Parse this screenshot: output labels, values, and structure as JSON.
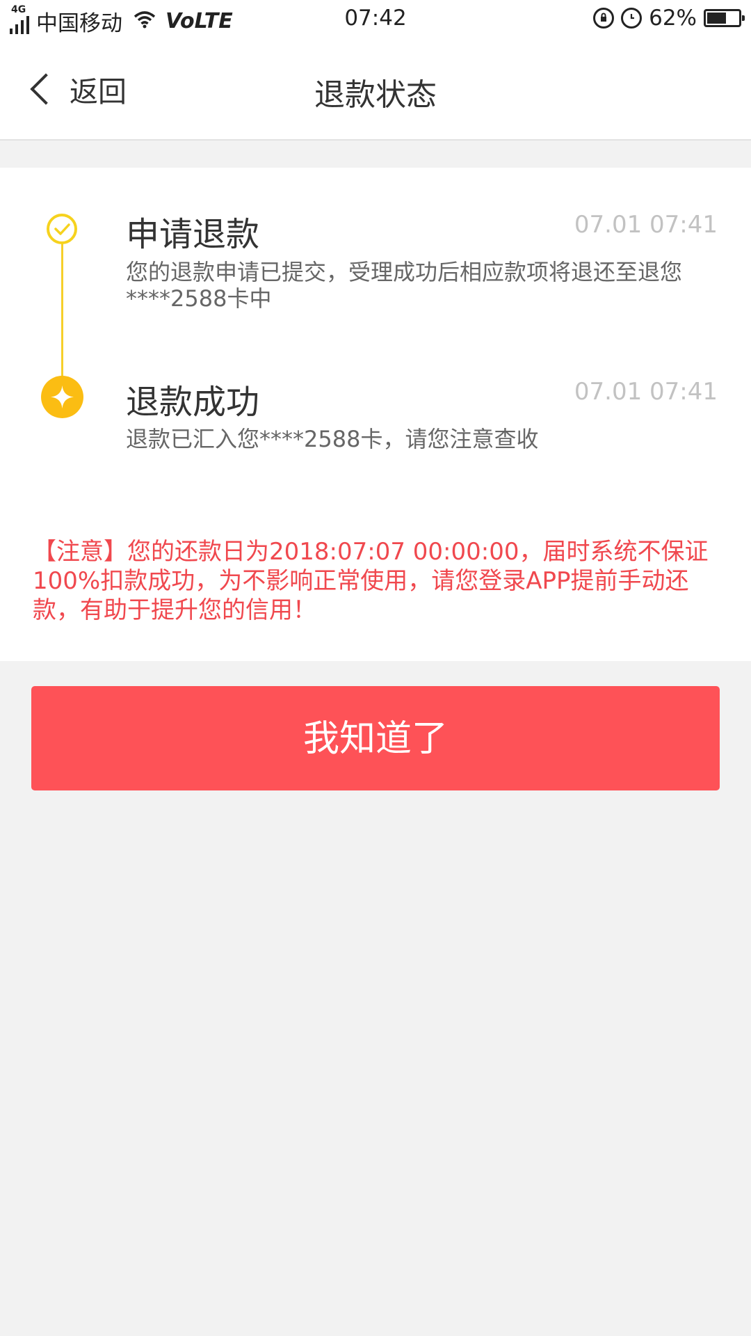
{
  "status_bar": {
    "network_type": "4G",
    "carrier": "中国移动",
    "volte": "VoLTE",
    "time": "07:42",
    "battery_percent": "62%",
    "battery_level": 0.62,
    "icons": [
      "signal-icon",
      "wifi-icon",
      "rotation-lock-icon",
      "alarm-icon",
      "battery-icon"
    ]
  },
  "nav": {
    "back_label": "返回",
    "title": "退款状态"
  },
  "timeline": [
    {
      "title": "申请退款",
      "time": "07.01 07:41",
      "description": "您的退款申请已提交，受理成功后相应款项将退还至退您****2588卡中",
      "icon": "check-circle-icon",
      "color": "#f6d21e"
    },
    {
      "title": "退款成功",
      "time": "07.01 07:41",
      "description": "退款已汇入您****2588卡，请您注意查收",
      "icon": "sparkle-circle-icon",
      "color": "#fbbd13"
    }
  ],
  "notice": "【注意】您的还款日为2018:07:07 00:00:00，届时系统不保证100%扣款成功，为不影响正常使用，请您登录APP提前手动还款，有助于提升您的信用！",
  "confirm_button": "我知道了",
  "colors": {
    "accent_red": "#fe5257",
    "notice_red": "#f0484e",
    "timeline_yellow": "#f6cf2a",
    "background": "#f2f2f2"
  }
}
